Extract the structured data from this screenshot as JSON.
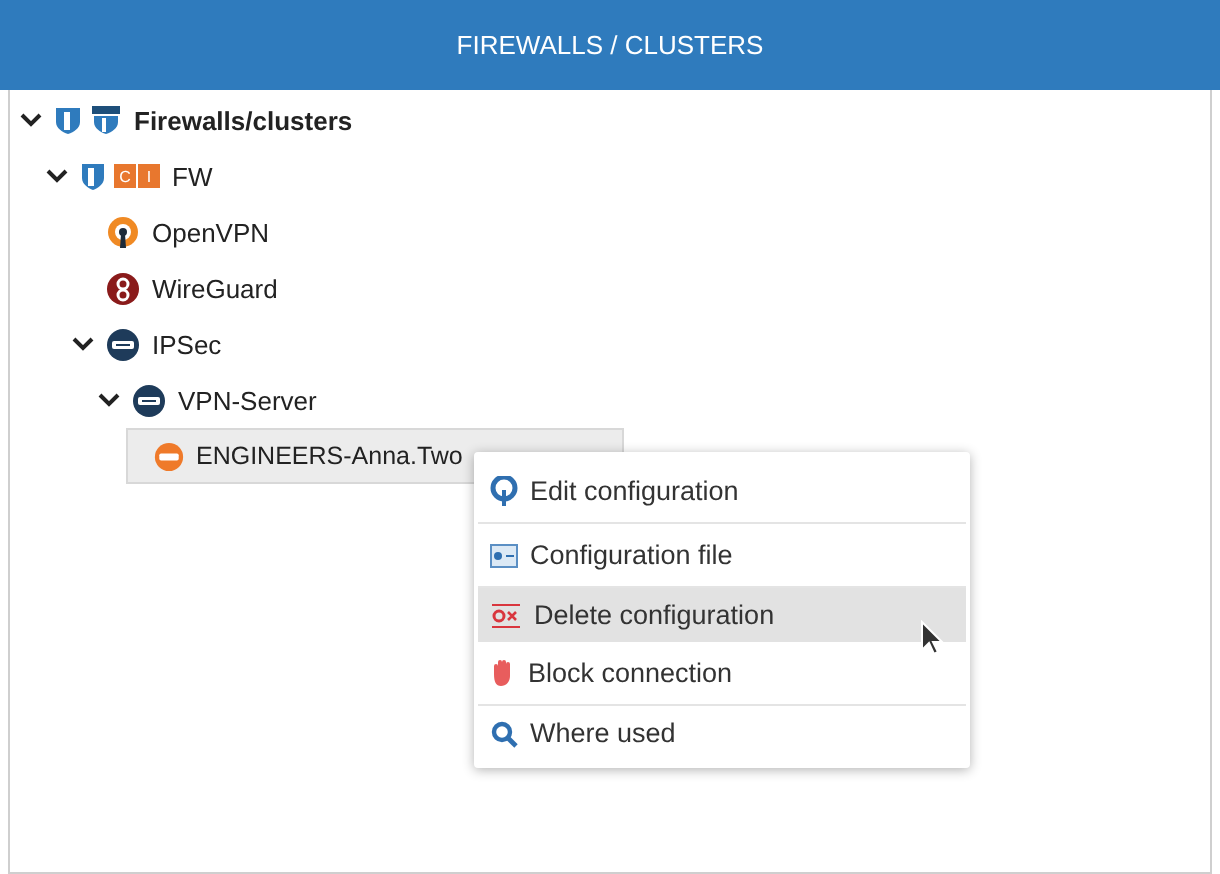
{
  "header": {
    "title": "FIREWALLS / CLUSTERS"
  },
  "tree": [
    {
      "label": "Firewalls/clusters",
      "kind": "root",
      "expanded": true,
      "selected": false,
      "children": [
        {
          "label": "FW",
          "kind": "firewall",
          "badge": [
            "C",
            "I"
          ],
          "expanded": true,
          "selected": false,
          "children": [
            {
              "label": "OpenVPN",
              "kind": "openvpn",
              "selected": false
            },
            {
              "label": "WireGuard",
              "kind": "wireguard",
              "selected": false
            },
            {
              "label": "IPSec",
              "kind": "ipsec",
              "expanded": true,
              "selected": false,
              "children": [
                {
                  "label": "VPN-Server",
                  "kind": "ipsec",
                  "expanded": true,
                  "selected": false,
                  "children": [
                    {
                      "label": "ENGINEERS-Anna.Two",
                      "kind": "connection",
                      "selected": true
                    }
                  ]
                }
              ]
            }
          ]
        }
      ]
    }
  ],
  "context_menu": {
    "items": [
      {
        "label": "Edit configuration",
        "kind": "edit",
        "selected": false,
        "divider_after": true
      },
      {
        "label": "Configuration file",
        "kind": "file",
        "selected": false,
        "divider_after": true
      },
      {
        "label": "Delete configuration",
        "kind": "delete",
        "selected": true,
        "divider_after": false
      },
      {
        "label": "Block connection",
        "kind": "block",
        "selected": false,
        "divider_after": true
      },
      {
        "label": "Where used",
        "kind": "search",
        "selected": false,
        "divider_after": false
      }
    ]
  }
}
